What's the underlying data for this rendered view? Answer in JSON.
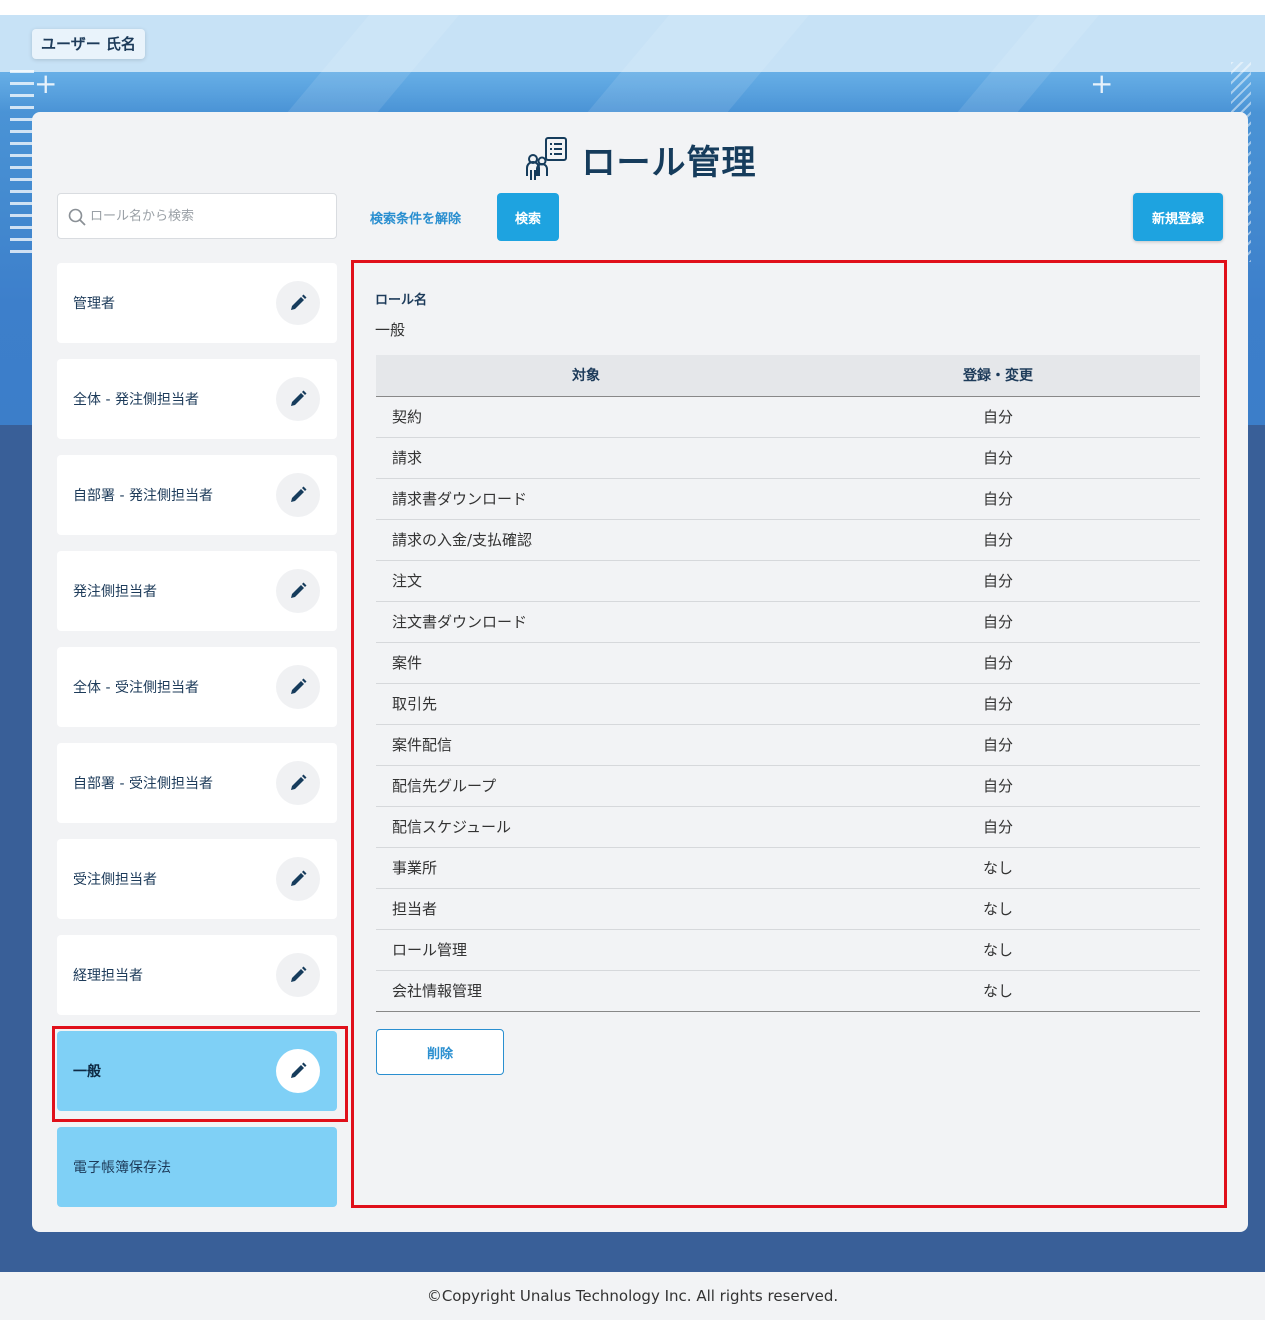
{
  "header": {
    "user_name": "ユーザー 氏名"
  },
  "page": {
    "title": "ロール管理",
    "title_icon": "role-management-icon"
  },
  "search": {
    "placeholder": "ロール名から検索",
    "value": "",
    "clear_label": "検索条件を解除",
    "search_label": "検索",
    "new_label": "新規登録"
  },
  "roles": [
    {
      "label": "管理者",
      "style": "normal"
    },
    {
      "label": "全体 - 発注側担当者",
      "style": "normal"
    },
    {
      "label": "自部署 - 発注側担当者",
      "style": "normal"
    },
    {
      "label": "発注側担当者",
      "style": "normal"
    },
    {
      "label": "全体 - 受注側担当者",
      "style": "normal"
    },
    {
      "label": "自部署 - 受注側担当者",
      "style": "normal"
    },
    {
      "label": "受注側担当者",
      "style": "normal"
    },
    {
      "label": "経理担当者",
      "style": "normal"
    },
    {
      "label": "一般",
      "style": "active"
    },
    {
      "label": "電子帳簿保存法",
      "style": "plain"
    }
  ],
  "detail": {
    "role_name_label": "ロール名",
    "role_name_value": "一般",
    "table": {
      "headers": [
        "対象",
        "登録・変更"
      ],
      "rows": [
        [
          "契約",
          "自分"
        ],
        [
          "請求",
          "自分"
        ],
        [
          "請求書ダウンロード",
          "自分"
        ],
        [
          "請求の入金/支払確認",
          "自分"
        ],
        [
          "注文",
          "自分"
        ],
        [
          "注文書ダウンロード",
          "自分"
        ],
        [
          "案件",
          "自分"
        ],
        [
          "取引先",
          "自分"
        ],
        [
          "案件配信",
          "自分"
        ],
        [
          "配信先グループ",
          "自分"
        ],
        [
          "配信スケジュール",
          "自分"
        ],
        [
          "事業所",
          "なし"
        ],
        [
          "担当者",
          "なし"
        ],
        [
          "ロール管理",
          "なし"
        ],
        [
          "会社情報管理",
          "なし"
        ]
      ]
    },
    "delete_label": "削除"
  },
  "footer": {
    "copyright": "©Copyright Unalus Technology Inc. All rights reserved."
  },
  "colors": {
    "accent": "#1ea3e0",
    "active_role": "#7fd0f6",
    "highlight_border": "#e0101a",
    "title_text": "#163c5c"
  }
}
